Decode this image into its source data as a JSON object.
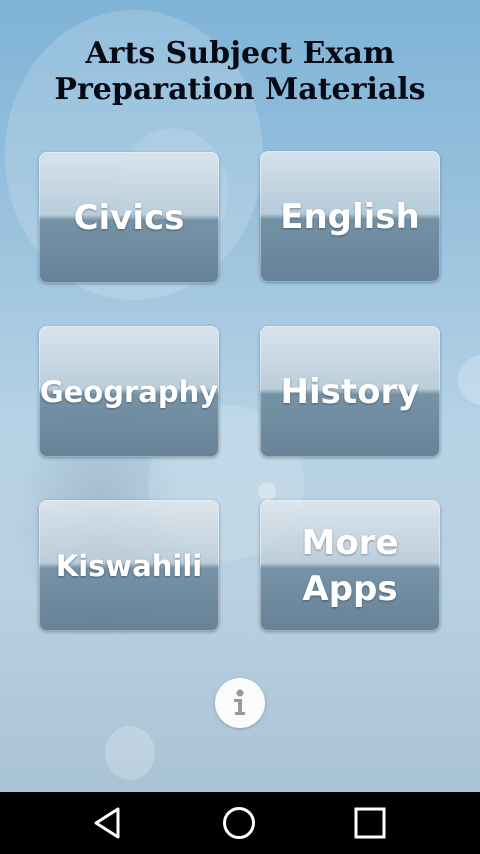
{
  "header": {
    "title_line1": "Arts Subject Exam",
    "title_line2": "Preparation Materials"
  },
  "subjects": [
    {
      "label": "Civics"
    },
    {
      "label": "English"
    },
    {
      "label": "Geography"
    },
    {
      "label": "History"
    },
    {
      "label": "Kiswahili"
    },
    {
      "label_line1": "More",
      "label_line2": "Apps"
    }
  ],
  "info_icon": "info-icon",
  "navigation_bar": {
    "back": "back-triangle-icon",
    "home": "home-circle-icon",
    "recents": "recents-square-icon"
  }
}
